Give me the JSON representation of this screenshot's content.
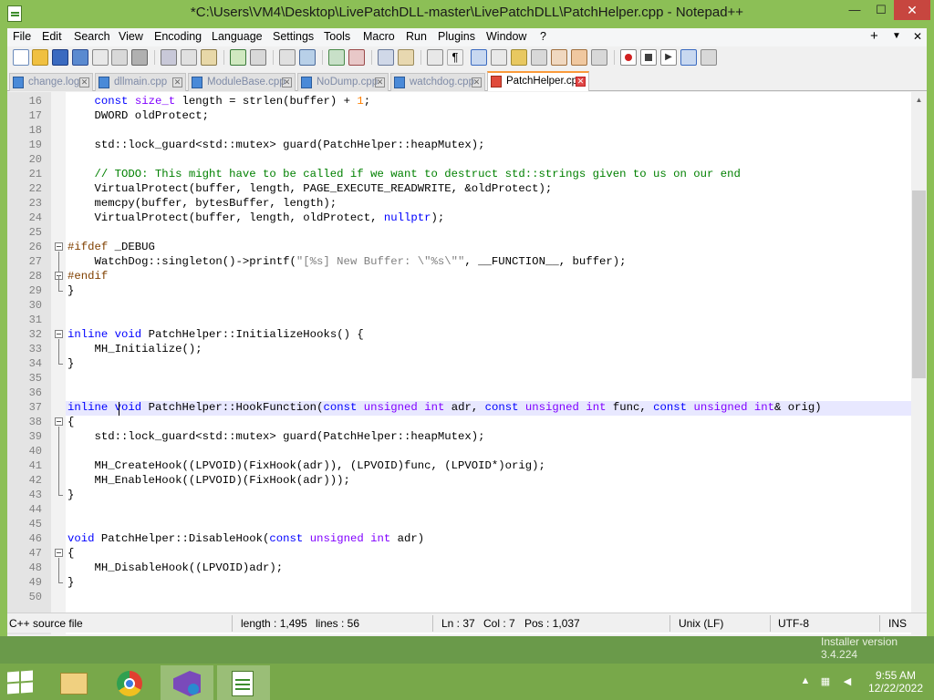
{
  "window": {
    "title": "*C:\\Users\\VM4\\Desktop\\LivePatchDLL-master\\LivePatchDLL\\PatchHelper.cpp - Notepad++",
    "min_glyph": "—",
    "max_glyph": "☐",
    "close_glyph": "✕"
  },
  "menu": {
    "items": [
      "File",
      "Edit",
      "Search",
      "View",
      "Encoding",
      "Language",
      "Settings",
      "Tools",
      "Macro",
      "Run",
      "Plugins",
      "Window",
      "?"
    ],
    "right": [
      "+",
      "▼",
      "✕"
    ]
  },
  "tabs": [
    {
      "label": "change.log",
      "active": false
    },
    {
      "label": "dllmain.cpp",
      "active": false
    },
    {
      "label": "ModuleBase.cpp",
      "active": false
    },
    {
      "label": "NoDump.cpp",
      "active": false
    },
    {
      "label": "watchdog.cpp",
      "active": false
    },
    {
      "label": "PatchHelper.cpp",
      "active": true
    }
  ],
  "editor": {
    "lines": [
      {
        "n": "16",
        "t": "    const size_t length = strlen(buffer) + 1;"
      },
      {
        "n": "17",
        "t": "    DWORD oldProtect;"
      },
      {
        "n": "18",
        "t": ""
      },
      {
        "n": "19",
        "t": "    std::lock_guard<std::mutex> guard(PatchHelper::heapMutex);"
      },
      {
        "n": "20",
        "t": ""
      },
      {
        "n": "21",
        "t": "    // TODO: This might have to be called if we want to destruct std::strings given to us on our end"
      },
      {
        "n": "22",
        "t": "    VirtualProtect(buffer, length, PAGE_EXECUTE_READWRITE, &oldProtect);"
      },
      {
        "n": "23",
        "t": "    memcpy(buffer, bytesBuffer, length);"
      },
      {
        "n": "24",
        "t": "    VirtualProtect(buffer, length, oldProtect, nullptr);"
      },
      {
        "n": "25",
        "t": ""
      },
      {
        "n": "26",
        "t": "#ifdef _DEBUG"
      },
      {
        "n": "27",
        "t": "    WatchDog::singleton()->printf(\"[%s] New Buffer: \\\"%s\\\"\", __FUNCTION__, buffer);"
      },
      {
        "n": "28",
        "t": "#endif"
      },
      {
        "n": "29",
        "t": "}"
      },
      {
        "n": "30",
        "t": ""
      },
      {
        "n": "31",
        "t": ""
      },
      {
        "n": "32",
        "t": "inline void PatchHelper::InitializeHooks() {"
      },
      {
        "n": "33",
        "t": "    MH_Initialize();"
      },
      {
        "n": "34",
        "t": "}"
      },
      {
        "n": "35",
        "t": ""
      },
      {
        "n": "36",
        "t": ""
      },
      {
        "n": "37",
        "t": "inline void PatchHelper::HookFunction(const unsigned int adr, const unsigned int func, const unsigned int& orig)"
      },
      {
        "n": "38",
        "t": "{"
      },
      {
        "n": "39",
        "t": "    std::lock_guard<std::mutex> guard(PatchHelper::heapMutex);"
      },
      {
        "n": "40",
        "t": ""
      },
      {
        "n": "41",
        "t": "    MH_CreateHook((LPVOID)(FixHook(adr)), (LPVOID)func, (LPVOID*)orig);"
      },
      {
        "n": "42",
        "t": "    MH_EnableHook((LPVOID)(FixHook(adr)));"
      },
      {
        "n": "43",
        "t": "}"
      },
      {
        "n": "44",
        "t": ""
      },
      {
        "n": "45",
        "t": ""
      },
      {
        "n": "46",
        "t": "void PatchHelper::DisableHook(const unsigned int adr)"
      },
      {
        "n": "47",
        "t": "{"
      },
      {
        "n": "48",
        "t": "    MH_DisableHook((LPVOID)adr);"
      },
      {
        "n": "49",
        "t": "}"
      },
      {
        "n": "50",
        "t": ""
      }
    ]
  },
  "status": {
    "filetype": "C++ source file",
    "length": "length : 1,495",
    "lines": "lines : 56",
    "ln": "Ln : 37",
    "col": "Col : 7",
    "pos": "Pos : 1,037",
    "eol": "Unix (LF)",
    "encoding": "UTF-8",
    "mode": "INS"
  },
  "desktop": {
    "installer_text": "Installer version 3.4.224"
  },
  "taskbar": {
    "time": "9:55 AM",
    "date": "12/22/2022",
    "apps": [
      "file-explorer",
      "chrome",
      "visual-studio-installer",
      "notepad-plus-plus"
    ]
  },
  "colors": {
    "window_frame": "#8cbf56",
    "keyword": "#0000ff",
    "type": "#8000ff",
    "comment": "#008000",
    "string": "#808080",
    "preprocessor": "#804000",
    "number": "#ff8000",
    "current_line": "#e8e8ff",
    "close_button": "#c7463f"
  }
}
